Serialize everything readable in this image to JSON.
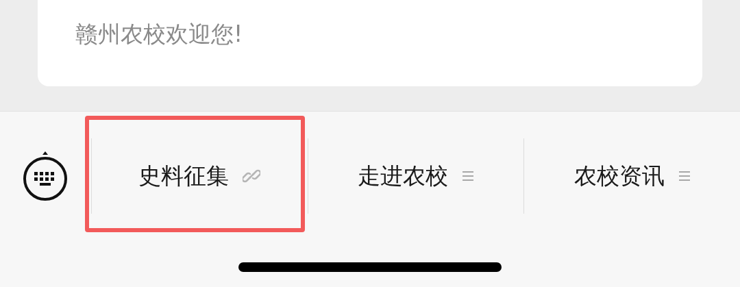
{
  "message": {
    "text": "赣州农校欢迎您!"
  },
  "menu": [
    {
      "label": "史料征集",
      "kind": "link",
      "highlighted": true
    },
    {
      "label": "走进农校",
      "kind": "submenu",
      "highlighted": false
    },
    {
      "label": "农校资讯",
      "kind": "submenu",
      "highlighted": false
    }
  ]
}
